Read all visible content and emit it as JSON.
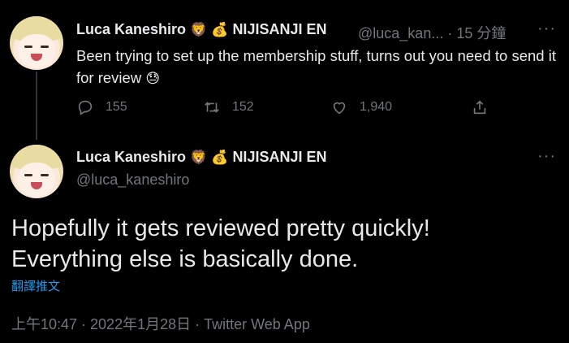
{
  "reply_tweet": {
    "display_name": "Luca Kaneshiro",
    "emoji_1": "🦁",
    "emoji_2": "💰",
    "org": "NIJISANJI EN",
    "handle": "@luca_kan...",
    "separator": "·",
    "time_ago": "15 分鐘",
    "text": "Been trying to set up the membership stuff, turns out you need to send it for review",
    "text_emoji": "😓",
    "more_label": "···",
    "stats": {
      "replies": "155",
      "retweets": "152",
      "likes": "1,940"
    }
  },
  "main_tweet": {
    "display_name": "Luca Kaneshiro",
    "emoji_1": "🦁",
    "emoji_2": "💰",
    "org": "NIJISANJI EN",
    "handle": "@luca_kaneshiro",
    "more_label": "···",
    "text_line1": "Hopefully it gets reviewed pretty quickly!",
    "text_line2": "Everything else is basically done.",
    "translate_label": "翻譯推文",
    "timestamp": "上午10:47 · 2022年1月28日 · Twitter Web App"
  },
  "colors": {
    "background": "#000000",
    "text": "#e7e9ea",
    "secondary": "#71767b",
    "link": "#1d9bf0"
  },
  "icons": [
    "reply-icon",
    "retweet-icon",
    "like-icon",
    "share-icon",
    "more-icon"
  ]
}
